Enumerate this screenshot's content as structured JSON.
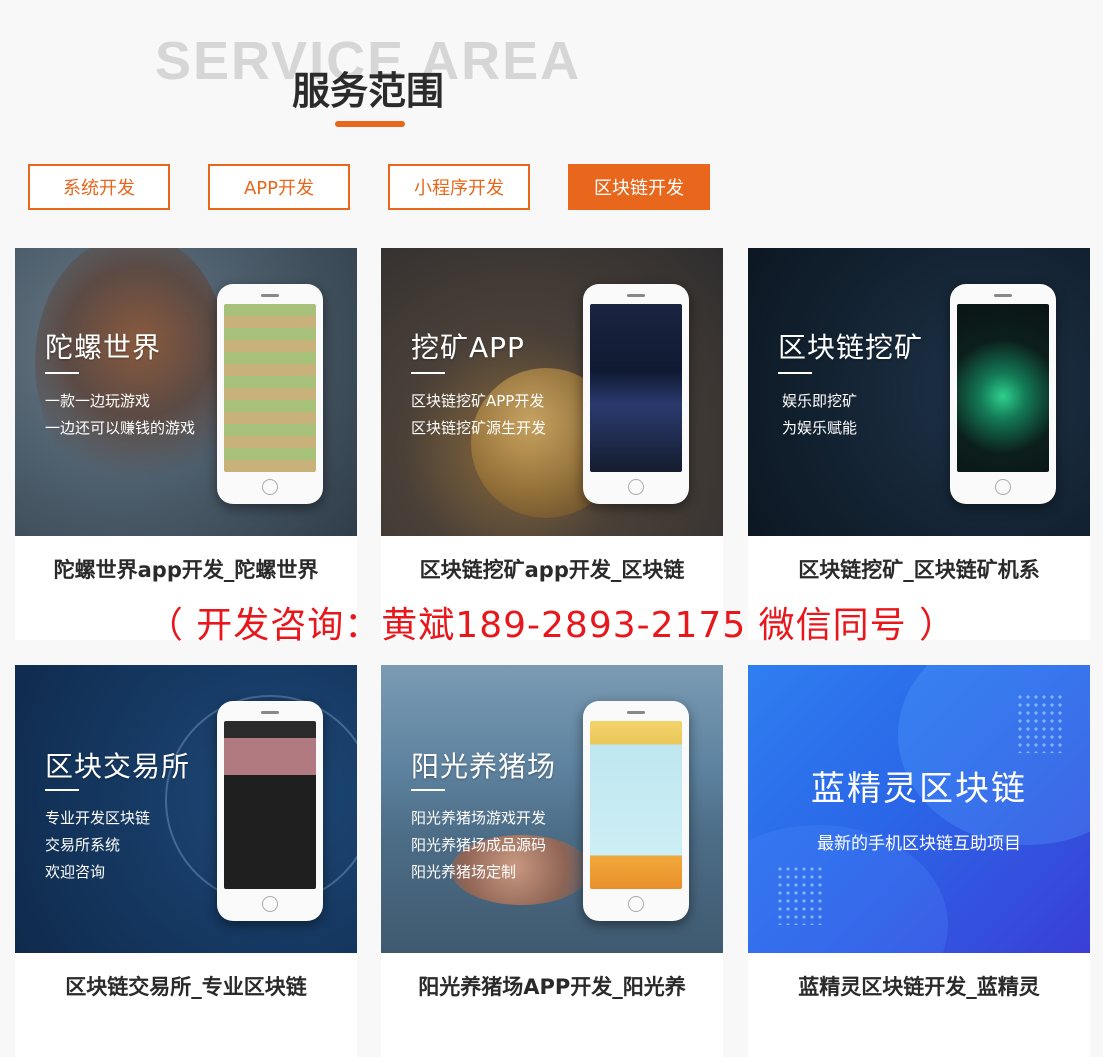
{
  "header": {
    "watermark": "SERVICE AREA",
    "title": "服务范围"
  },
  "tabs": [
    {
      "label": "系统开发",
      "active": false
    },
    {
      "label": "APP开发",
      "active": false
    },
    {
      "label": "小程序开发",
      "active": false
    },
    {
      "label": "区块链开发",
      "active": true
    }
  ],
  "cards": [
    {
      "title": "陀螺世界",
      "lines": [
        "一款一边玩游戏",
        "一边还可以赚钱的游戏"
      ],
      "caption": "陀螺世界app开发_陀螺世界"
    },
    {
      "title": "挖矿APP",
      "lines": [
        "区块链挖矿APP开发",
        "区块链挖矿源生开发"
      ],
      "caption": "区块链挖矿app开发_区块链"
    },
    {
      "title": "区块链挖矿",
      "lines": [
        "娱乐即挖矿",
        "为娱乐赋能"
      ],
      "caption": "区块链挖矿_区块链矿机系"
    },
    {
      "title": "区块交易所",
      "lines": [
        "专业开发区块链",
        "交易所系统",
        "欢迎咨询"
      ],
      "caption": "区块链交易所_专业区块链"
    },
    {
      "title": "阳光养猪场",
      "lines": [
        "阳光养猪场游戏开发",
        "阳光养猪场成品源码",
        "阳光养猪场定制"
      ],
      "caption": "阳光养猪场APP开发_阳光养"
    },
    {
      "title": "蓝精灵区块链",
      "lines": [
        "最新的手机区块链互助项目"
      ],
      "caption": "蓝精灵区块链开发_蓝精灵"
    }
  ],
  "consult": "（ 开发咨询：黄斌189-2893-2175 微信同号 ）",
  "colors": {
    "accent": "#e8671c",
    "consult": "#e8171c"
  }
}
